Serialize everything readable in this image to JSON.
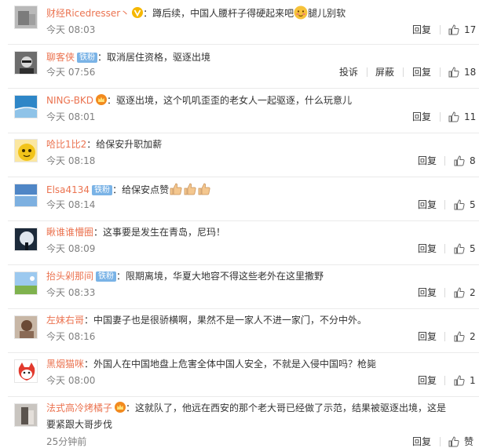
{
  "colors": {
    "username": "#eb7350",
    "badge": "#7ab3e6",
    "time": "#808080",
    "text": "#333333"
  },
  "actions": {
    "reply": "回复",
    "report": "投诉",
    "block": "屏蔽"
  },
  "comments": [
    {
      "user": "财经Ricedresser丶",
      "badge": "",
      "text": "：蹲后续，中国人腰杆子得硬起来吧",
      "text_after": "腿儿别软",
      "time": "今天 08:03",
      "likes": "17"
    },
    {
      "user": "聊客侠",
      "badge": "铁粉",
      "text": "：取消居住资格，驱逐出境",
      "time": "今天 07:56",
      "likes": "18"
    },
    {
      "user": "NING-BKD",
      "badge": "",
      "text": "：驱逐出境，这个叽叽歪歪的老女人一起驱逐，什么玩意儿",
      "time": "今天 08:01",
      "likes": "11"
    },
    {
      "user": "哈比1比2",
      "badge": "",
      "text": "：给保安升职加薪",
      "time": "今天 08:18",
      "likes": "8"
    },
    {
      "user": "Elsa4134",
      "badge": "铁粉",
      "text": "：给保安点赞",
      "time": "今天 08:14",
      "likes": "5"
    },
    {
      "user": "瞅谁谁懵圈",
      "badge": "",
      "text": "：这事要是发生在青岛，尼玛！",
      "time": "今天 08:09",
      "likes": "5"
    },
    {
      "user": "抬头剁那间",
      "badge": "铁粉",
      "text": "：限期离境，华夏大地容不得这些老外在这里撒野",
      "time": "今天 08:33",
      "likes": "2"
    },
    {
      "user": "左妹右哥",
      "badge": "",
      "text": "：中国妻子也是很骄横啊，果然不是一家人不进一家门，不分中外。",
      "time": "今天 08:16",
      "likes": "2"
    },
    {
      "user": "黑烟猫咪",
      "badge": "",
      "text": "：外国人在中国地盘上危害全体中国人安全，不就是入侵中国吗？枪毙",
      "time": "今天 08:00",
      "likes": "1"
    },
    {
      "user": "法式高冷烤橘子",
      "badge": "",
      "text": "：这就队了，他远在西安的那个老大哥已经做了示范，结果被驱逐出境，这是",
      "text_line2": "要紧跟大哥步伐",
      "time": "25分钟前",
      "likes": "赞"
    }
  ]
}
